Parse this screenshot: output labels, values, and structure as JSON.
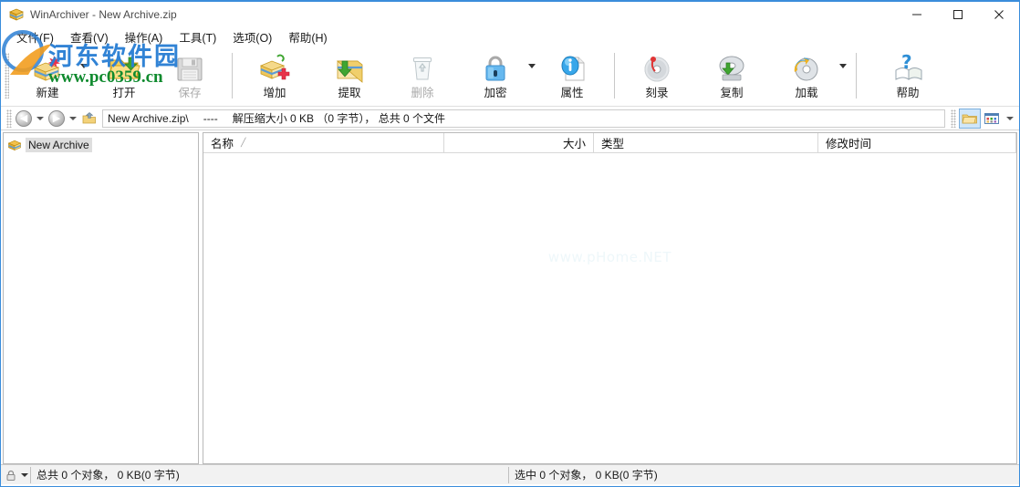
{
  "window": {
    "title": "WinArchiver - New Archive.zip",
    "app_icon": "archive-icon",
    "minimize_label": "—",
    "maximize_label": "□",
    "close_label": "✕"
  },
  "menu": {
    "items": [
      {
        "label": "文件(F)",
        "name": "menu-file"
      },
      {
        "label": "查看(V)",
        "name": "menu-view"
      },
      {
        "label": "操作(A)",
        "name": "menu-action"
      },
      {
        "label": "工具(T)",
        "name": "menu-tools"
      },
      {
        "label": "选项(O)",
        "name": "menu-options"
      },
      {
        "label": "帮助(H)",
        "name": "menu-help"
      }
    ]
  },
  "toolbar": {
    "groups": [
      {
        "buttons": [
          {
            "label": "新建",
            "icon": "new-archive-icon",
            "disabled": false,
            "caret": true
          },
          {
            "label": "打开",
            "icon": "open-folder-icon",
            "disabled": false,
            "caret": false
          },
          {
            "label": "保存",
            "icon": "save-floppy-icon",
            "disabled": true,
            "caret": false
          }
        ]
      },
      {
        "buttons": [
          {
            "label": "增加",
            "icon": "add-files-icon",
            "disabled": false,
            "caret": false
          },
          {
            "label": "提取",
            "icon": "extract-icon",
            "disabled": false,
            "caret": false
          },
          {
            "label": "删除",
            "icon": "delete-trash-icon",
            "disabled": true,
            "caret": false
          },
          {
            "label": "加密",
            "icon": "encrypt-lock-icon",
            "disabled": false,
            "caret": true
          },
          {
            "label": "属性",
            "icon": "properties-info-icon",
            "disabled": false,
            "caret": false
          }
        ]
      },
      {
        "buttons": [
          {
            "label": "刻录",
            "icon": "burn-disc-icon",
            "disabled": false,
            "caret": false
          },
          {
            "label": "复制",
            "icon": "copy-disc-icon",
            "disabled": false,
            "caret": false
          },
          {
            "label": "加载",
            "icon": "mount-disc-icon",
            "disabled": false,
            "caret": true
          }
        ]
      },
      {
        "buttons": [
          {
            "label": "帮助",
            "icon": "help-question-icon",
            "disabled": false,
            "caret": false
          }
        ]
      }
    ]
  },
  "addressbar": {
    "back_icon": "back-arrow-icon",
    "forward_icon": "forward-arrow-icon",
    "up_icon": "up-folder-icon",
    "back_glyph": "◀",
    "forward_glyph": "▶",
    "path": "New Archive.zip\\",
    "separator": "----",
    "info": "解压缩大小 0 KB （0 字节）， 总共 0 个文件",
    "view_folder_icon": "folder-view-icon",
    "view_details_icon": "details-view-icon",
    "view_caret": "▼"
  },
  "tree": {
    "items": [
      {
        "label": "New Archive",
        "icon": "archive-icon",
        "selected": true
      }
    ]
  },
  "list": {
    "columns": [
      {
        "label": "名称",
        "name": "column-name",
        "sort": "╱"
      },
      {
        "label": "大小",
        "name": "column-size",
        "sort": ""
      },
      {
        "label": "类型",
        "name": "column-type",
        "sort": ""
      },
      {
        "label": "修改时间",
        "name": "column-modified",
        "sort": ""
      }
    ],
    "rows": [],
    "watermark": "www.pHome.NET"
  },
  "statusbar": {
    "lock_icon": "lock-icon",
    "total": "总共 0 个对象，  0 KB(0 字节)",
    "selected": "选中 0 个对象，  0 KB(0 字节)"
  },
  "watermark": {
    "site_cn": "河东软件园",
    "site_url": "www.pc0359.cn"
  },
  "colors": {
    "accent": "#3a8ddb",
    "title_text": "#4a4a4a",
    "disabled": "#aaaaaa",
    "status_bg": "#f2f2f2",
    "selection": "#dedede"
  }
}
